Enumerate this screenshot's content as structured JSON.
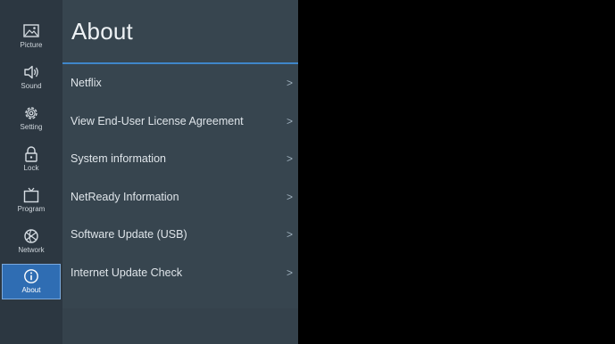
{
  "sidebar": {
    "items": [
      {
        "label": "Picture",
        "icon": "picture-icon"
      },
      {
        "label": "Sound",
        "icon": "speaker-icon"
      },
      {
        "label": "Setting",
        "icon": "gear-icon"
      },
      {
        "label": "Lock",
        "icon": "lock-icon"
      },
      {
        "label": "Program",
        "icon": "tv-icon"
      },
      {
        "label": "Network",
        "icon": "globe-icon"
      },
      {
        "label": "About",
        "icon": "info-icon",
        "active": true
      }
    ]
  },
  "panel": {
    "title": "About",
    "items": [
      {
        "label": "Netflix"
      },
      {
        "label": "View End-User License Agreement"
      },
      {
        "label": "System information"
      },
      {
        "label": "NetReady Information"
      },
      {
        "label": "Software Update (USB)"
      },
      {
        "label": "Internet Update Check"
      }
    ],
    "chevron": ">"
  },
  "colors": {
    "rail_bg": "#2c3741",
    "panel_bg": "#37454f",
    "accent": "#3f86c9",
    "active_bg": "#2f6db3"
  }
}
